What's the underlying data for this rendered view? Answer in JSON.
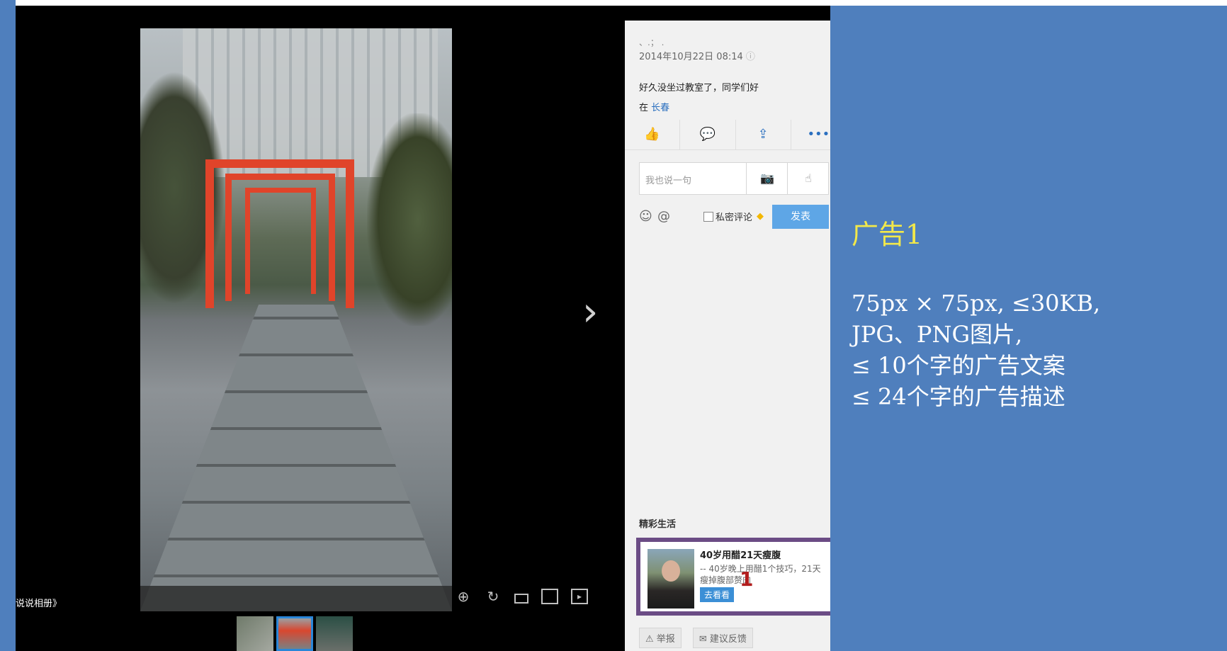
{
  "album_link": "说说相册》",
  "viewer_tools": [
    "zoom-in-icon",
    "rotate-icon",
    "fit-icon",
    "fullscreen-icon",
    "slideshow-icon"
  ],
  "thumbnails": [
    {
      "name": "thumb-1"
    },
    {
      "name": "thumb-2",
      "active": true
    },
    {
      "name": "thumb-3"
    }
  ],
  "panel": {
    "close_icon": "×",
    "username": "、.；  .   ",
    "datetime": "2014年10月22日 08:14",
    "post_text": "好久没坐过教室了，同学们好",
    "location_prefix": "在",
    "location_name": "长春",
    "actions": [
      "like-icon",
      "comment-icon",
      "share-icon",
      "more-icon"
    ],
    "comment_placeholder": "我也说一句",
    "private_comment": "私密评论",
    "publish": "发表",
    "section_title": "精彩生活",
    "ad": {
      "title": "40岁用醋21天瘦腹",
      "desc": "-- 40岁晚上用醋1个技巧，21天瘦掉腹部赘肉",
      "button": "去看看",
      "mark": "1"
    },
    "report": "举报",
    "feedback": "建议反馈"
  },
  "right_panel": {
    "label": "广告1",
    "line1": "75px × 75px, ≤30KB,",
    "line2": "JPG、PNG图片,",
    "line3": "≤ 10个字的广告文案",
    "line4": "≤ 24个字的广告描述"
  },
  "colors": {
    "blue_panel": "#4f7fbd",
    "yellow_label": "#f2e84a",
    "ad_border": "#6b4c85",
    "publish_button": "#5ea6e6"
  }
}
